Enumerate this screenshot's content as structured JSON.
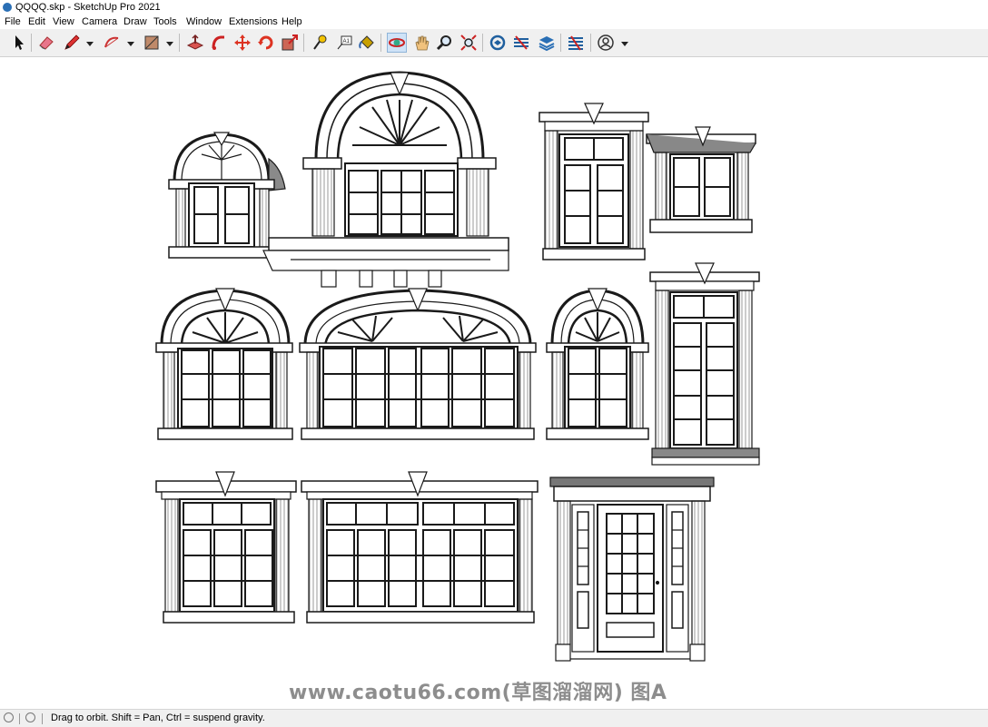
{
  "window": {
    "title": "QQQQ.skp - SketchUp Pro 2021"
  },
  "menu": [
    "File",
    "Edit",
    "View",
    "Camera",
    "Draw",
    "Tools",
    "Window",
    "Extensions",
    "Help"
  ],
  "toolbar": {
    "tools": [
      {
        "name": "select-tool",
        "icon": "arrow-icon"
      },
      {
        "name": "eraser-tool",
        "icon": "eraser-icon"
      },
      {
        "name": "line-tool",
        "icon": "pencil-icon"
      },
      {
        "name": "arc-tool",
        "icon": "arc-icon"
      },
      {
        "name": "rectangle-tool",
        "icon": "rectangle-icon"
      },
      {
        "name": "push-pull-tool",
        "icon": "push-pull-icon"
      },
      {
        "name": "follow-me-tool",
        "icon": "follow-me-icon"
      },
      {
        "name": "move-tool",
        "icon": "move-icon"
      },
      {
        "name": "rotate-tool",
        "icon": "rotate-icon"
      },
      {
        "name": "scale-tool",
        "icon": "scale-icon"
      },
      {
        "name": "tape-measure-tool",
        "icon": "tape-icon"
      },
      {
        "name": "text-tool",
        "icon": "text-icon"
      },
      {
        "name": "paint-bucket-tool",
        "icon": "paint-bucket-icon"
      },
      {
        "name": "orbit-tool",
        "icon": "orbit-icon"
      },
      {
        "name": "pan-tool",
        "icon": "hand-icon"
      },
      {
        "name": "zoom-tool",
        "icon": "magnifier-icon"
      },
      {
        "name": "zoom-extents-tool",
        "icon": "zoom-extents-icon"
      },
      {
        "name": "3d-warehouse",
        "icon": "warehouse-icon"
      },
      {
        "name": "extension-warehouse",
        "icon": "extension-icon"
      },
      {
        "name": "layout-send",
        "icon": "layout-icon"
      },
      {
        "name": "extension-manager",
        "icon": "extension-manager-icon"
      },
      {
        "name": "account",
        "icon": "user-icon"
      }
    ]
  },
  "status": {
    "text": "Drag to orbit. Shift = Pan, Ctrl = suspend gravity."
  },
  "watermark": {
    "text": "www.caotu66.com(草图溜溜网) 图A"
  },
  "colors": {
    "toolbar_bg": "#f0f0f0",
    "line": "#1a1a1a",
    "active_tool_bg": "#cfe3f7"
  }
}
